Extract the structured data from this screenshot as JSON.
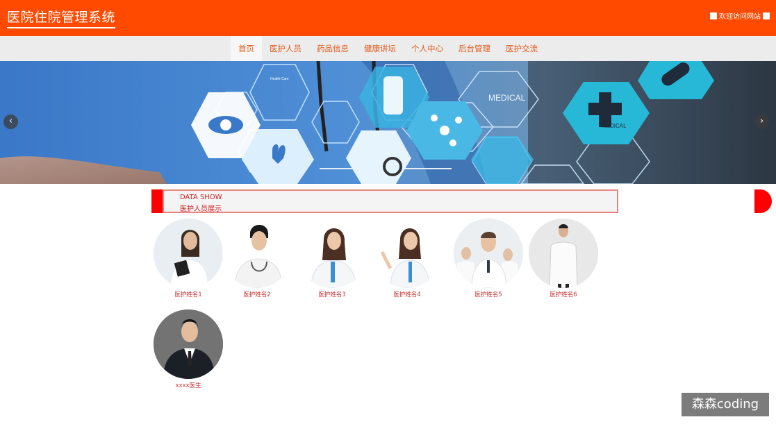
{
  "header": {
    "site_title": "医院住院管理系统",
    "welcome_link": "欢迎访问网站"
  },
  "nav": {
    "items": [
      {
        "label": "首页",
        "active": true
      },
      {
        "label": "医护人员",
        "active": false
      },
      {
        "label": "药品信息",
        "active": false
      },
      {
        "label": "健康讲坛",
        "active": false
      },
      {
        "label": "个人中心",
        "active": false
      },
      {
        "label": "后台管理",
        "active": false
      },
      {
        "label": "医护交流",
        "active": false
      }
    ]
  },
  "banner": {
    "texts": [
      "MEDICAL",
      "MEDICAL",
      "Health Care"
    ],
    "prev_icon": "chevron-left-icon",
    "next_icon": "chevron-right-icon"
  },
  "section": {
    "title_en": "DATA SHOW",
    "title_cn": "医护人员展示"
  },
  "staff": [
    {
      "name": "医护姓名1"
    },
    {
      "name": "医护姓名2"
    },
    {
      "name": "医护姓名3"
    },
    {
      "name": "医护姓名4"
    },
    {
      "name": "医护姓名5"
    },
    {
      "name": "医护姓名6"
    },
    {
      "name": "xxxx医生"
    }
  ],
  "watermark": "森森coding",
  "colors": {
    "header_bg": "#ff4a00",
    "nav_text": "#e35a1c",
    "section_red": "#ff0000",
    "name_text": "#c83232"
  }
}
